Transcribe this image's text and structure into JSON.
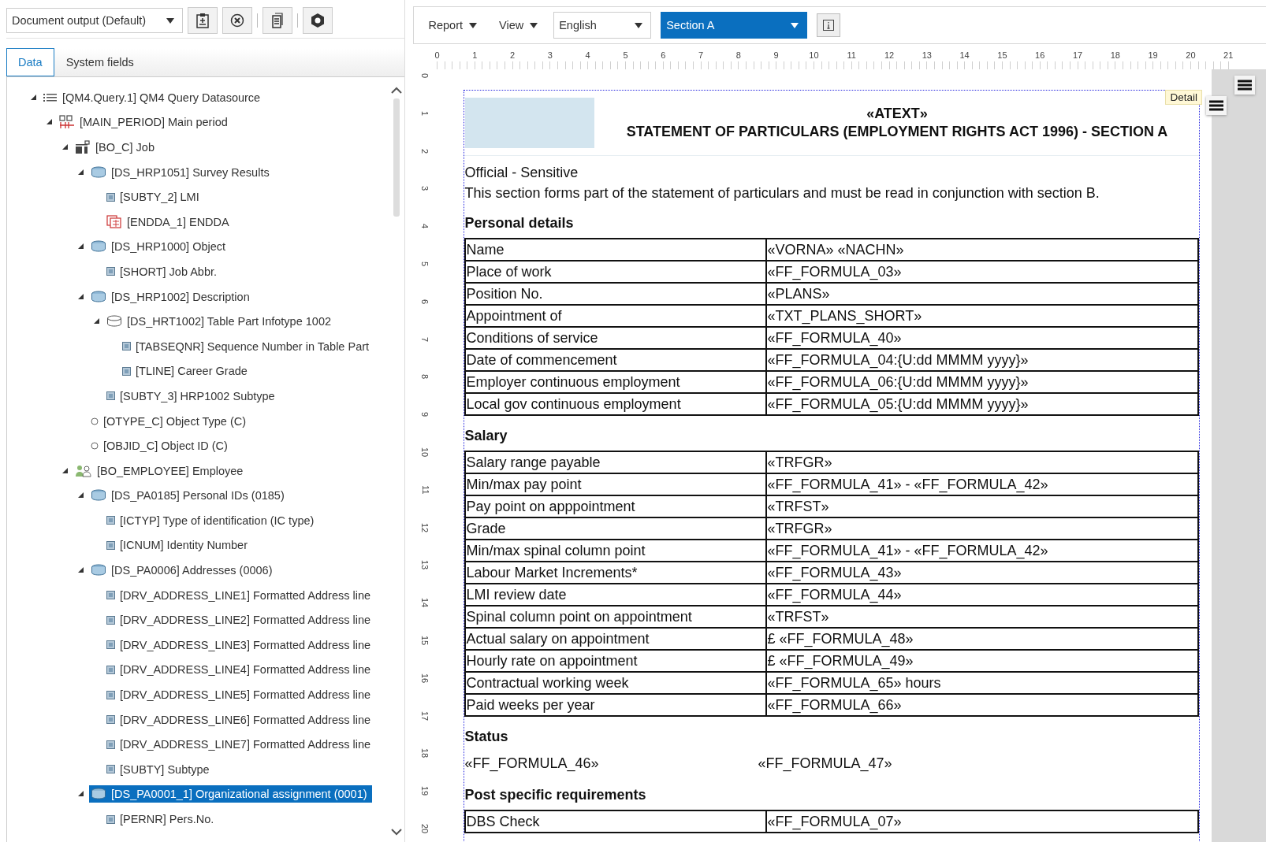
{
  "left_toolbar": {
    "output_select": "Document output (Default)"
  },
  "tabs": [
    {
      "label": "Data",
      "selected": true
    },
    {
      "label": "System fields",
      "selected": false
    }
  ],
  "tree": [
    {
      "label": "[QM4.Query.1] QM4 Query Datasource",
      "kind": "datasource",
      "expanded": true,
      "selected": false,
      "children": [
        {
          "label": "[MAIN_PERIOD] Main period",
          "kind": "period",
          "expanded": true,
          "selected": false,
          "children": [
            {
              "label": "[BO_C] Job",
              "kind": "business-object",
              "expanded": true,
              "selected": false,
              "children": [
                {
                  "label": "[DS_HRP1051] Survey Results",
                  "kind": "dataset",
                  "expanded": true,
                  "selected": false,
                  "children": [
                    {
                      "label": "[SUBTY_2] LMI",
                      "kind": "field",
                      "selected": false
                    },
                    {
                      "label": "[ENDDA_1] ENDDA",
                      "kind": "date",
                      "selected": false
                    }
                  ]
                },
                {
                  "label": "[DS_HRP1000] Object",
                  "kind": "dataset",
                  "expanded": true,
                  "selected": false,
                  "children": [
                    {
                      "label": "[SHORT] Job Abbr.",
                      "kind": "field",
                      "selected": false
                    }
                  ]
                },
                {
                  "label": "[DS_HRP1002] Description",
                  "kind": "dataset",
                  "expanded": true,
                  "selected": false,
                  "children": [
                    {
                      "label": "[DS_HRT1002] Table Part Infotype 1002",
                      "kind": "table-part",
                      "expanded": true,
                      "selected": false,
                      "children": [
                        {
                          "label": "[TABSEQNR] Sequence Number in Table Part",
                          "kind": "field",
                          "selected": false
                        },
                        {
                          "label": "[TLINE] Career Grade",
                          "kind": "field",
                          "selected": false
                        }
                      ]
                    },
                    {
                      "label": "[SUBTY_3] HRP1002 Subtype",
                      "kind": "field",
                      "selected": false
                    }
                  ]
                },
                {
                  "label": "[OTYPE_C] Object Type (C)",
                  "kind": "attribute",
                  "selected": false
                },
                {
                  "label": "[OBJID_C] Object ID (C)",
                  "kind": "attribute",
                  "selected": false
                }
              ]
            },
            {
              "label": "[BO_EMPLOYEE] Employee",
              "kind": "employee",
              "expanded": true,
              "selected": false,
              "children": [
                {
                  "label": "[DS_PA0185] Personal IDs (0185)",
                  "kind": "dataset",
                  "expanded": true,
                  "selected": false,
                  "children": [
                    {
                      "label": "[ICTYP] Type of identification (IC type)",
                      "kind": "field",
                      "selected": false
                    },
                    {
                      "label": "[ICNUM] Identity Number",
                      "kind": "field",
                      "selected": false
                    }
                  ]
                },
                {
                  "label": "[DS_PA0006] Addresses (0006)",
                  "kind": "dataset",
                  "expanded": true,
                  "selected": false,
                  "children": [
                    {
                      "label": "[DRV_ADDRESS_LINE1] Formatted Address line",
                      "kind": "field",
                      "selected": false
                    },
                    {
                      "label": "[DRV_ADDRESS_LINE2] Formatted Address line",
                      "kind": "field",
                      "selected": false
                    },
                    {
                      "label": "[DRV_ADDRESS_LINE3] Formatted Address line",
                      "kind": "field",
                      "selected": false
                    },
                    {
                      "label": "[DRV_ADDRESS_LINE4] Formatted Address line",
                      "kind": "field",
                      "selected": false
                    },
                    {
                      "label": "[DRV_ADDRESS_LINE5] Formatted Address line",
                      "kind": "field",
                      "selected": false
                    },
                    {
                      "label": "[DRV_ADDRESS_LINE6] Formatted Address line",
                      "kind": "field",
                      "selected": false
                    },
                    {
                      "label": "[DRV_ADDRESS_LINE7] Formatted Address line",
                      "kind": "field",
                      "selected": false
                    },
                    {
                      "label": "[SUBTY] Subtype",
                      "kind": "field",
                      "selected": false
                    }
                  ]
                },
                {
                  "label": "[DS_PA0001_1] Organizational assignment (0001)",
                  "kind": "dataset",
                  "expanded": true,
                  "selected": true,
                  "children": [
                    {
                      "label": "[PERNR] Pers.No.",
                      "kind": "field",
                      "selected": false
                    }
                  ]
                }
              ]
            }
          ]
        }
      ]
    }
  ],
  "toolbar": {
    "menus": [
      "Report",
      "View"
    ],
    "language": "English",
    "section": "Section A"
  },
  "ruler": {
    "horizontal": [
      "0",
      "1",
      "2",
      "3",
      "4",
      "5",
      "6",
      "7",
      "8",
      "9",
      "10",
      "11",
      "12",
      "13",
      "14",
      "15",
      "16",
      "17",
      "18",
      "19",
      "20",
      "21"
    ],
    "vertical": [
      "0",
      "1",
      "2",
      "3",
      "4",
      "5",
      "6",
      "7",
      "8",
      "9",
      "10",
      "11",
      "12",
      "13",
      "14",
      "15",
      "16",
      "17",
      "18",
      "19",
      "20"
    ]
  },
  "document": {
    "badge": "Detail",
    "title": [
      "«ATEXT»",
      "STATEMENT OF PARTICULARS (EMPLOYMENT RIGHTS ACT 1996) - SECTION A"
    ],
    "intro": [
      "Official - Sensitive",
      "This section forms part of the statement of particulars and must be read in conjunction with section B."
    ],
    "sections": [
      {
        "heading": "Personal details",
        "kind": "table",
        "rows": [
          {
            "label": "Name",
            "value": "«VORNA» «NACHN»"
          },
          {
            "label": "Place of work",
            "value": "«FF_FORMULA_03»"
          },
          {
            "label": "Position No.",
            "value": "«PLANS»"
          },
          {
            "label": "Appointment of",
            "value": "«TXT_PLANS_SHORT»"
          },
          {
            "label": "Conditions of service",
            "value": "«FF_FORMULA_40»"
          },
          {
            "label": "Date of commencement",
            "value": "«FF_FORMULA_04:{U:dd MMMM yyyy}»"
          },
          {
            "label": "Employer continuous employment",
            "value": "«FF_FORMULA_06:{U:dd MMMM yyyy}»"
          },
          {
            "label": "Local gov continuous employment",
            "value": "«FF_FORMULA_05:{U:dd MMMM yyyy}»"
          }
        ]
      },
      {
        "heading": "Salary",
        "kind": "table",
        "rows": [
          {
            "label": "Salary range payable",
            "value": "«TRFGR»"
          },
          {
            "label": "Min/max pay point",
            "value": "«FF_FORMULA_41» - «FF_FORMULA_42»"
          },
          {
            "label": "Pay point on apppointment",
            "value": "«TRFST»"
          },
          {
            "label": "Grade",
            "value": "«TRFGR»"
          },
          {
            "label": "Min/max spinal column point",
            "value": "«FF_FORMULA_41» - «FF_FORMULA_42»"
          },
          {
            "label": "Labour Market Increments*",
            "value": "«FF_FORMULA_43»"
          },
          {
            "label": "LMI review date",
            "value": "«FF_FORMULA_44»"
          },
          {
            "label": "Spinal column point on appointment",
            "value": "«TRFST»"
          },
          {
            "label": "Actual salary on appointment",
            "value": "£ «FF_FORMULA_48»"
          },
          {
            "label": "Hourly rate on appointment",
            "value": "£ «FF_FORMULA_49»"
          },
          {
            "label": "Contractual working week",
            "value": "«FF_FORMULA_65» hours"
          },
          {
            "label": "Paid weeks per year",
            "value": "«FF_FORMULA_66»"
          }
        ]
      },
      {
        "heading": "Status",
        "kind": "plain",
        "rows": [
          {
            "label": "«FF_FORMULA_46»",
            "value": "«FF_FORMULA_47»"
          }
        ]
      },
      {
        "heading": "Post specific requirements",
        "kind": "table",
        "rows": [
          {
            "label": "DBS Check",
            "value": "«FF_FORMULA_07»"
          }
        ]
      }
    ]
  }
}
